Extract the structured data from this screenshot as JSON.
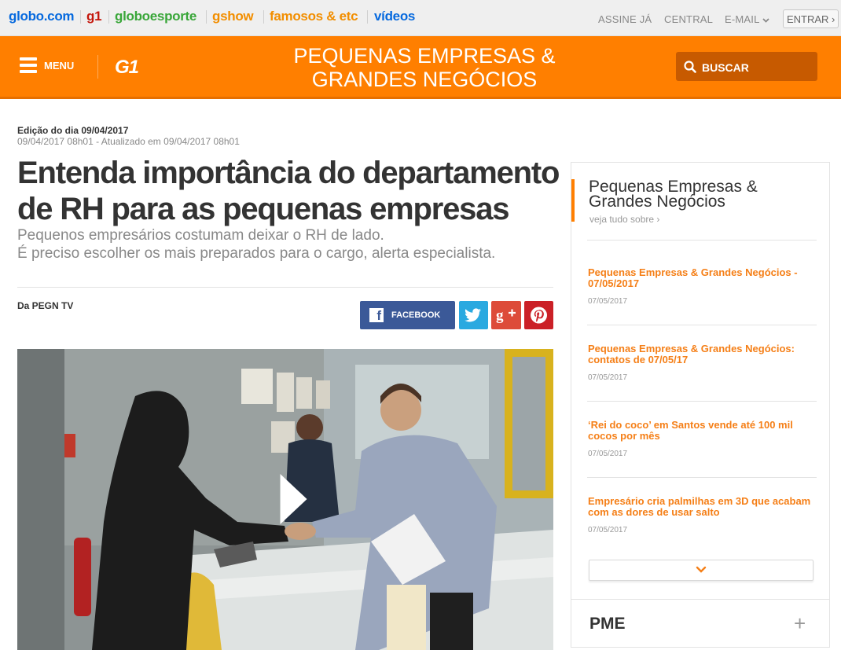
{
  "topbar": {
    "portals": [
      {
        "label": "globo.com",
        "color": "#0669de"
      },
      {
        "label": "g1",
        "color": "#c4170c"
      },
      {
        "label": "globoesporte",
        "color": "#39a639"
      },
      {
        "label": "gshow",
        "color": "#f28e00"
      },
      {
        "label": "famosos & etc",
        "color": "#f28e00"
      },
      {
        "label": "vídeos",
        "color": "#0669de"
      }
    ],
    "links": [
      "ASSINE JÁ",
      "CENTRAL",
      "E-MAIL"
    ],
    "login_label": "ENTRAR ›"
  },
  "header": {
    "menu_label": "MENU",
    "logo": "G1",
    "section_title": "PEQUENAS EMPRESAS & GRANDES NEGÓCIOS",
    "search_label": "BUSCAR",
    "color": "#ff7f00"
  },
  "article": {
    "edition": "Edição do dia 09/04/2017",
    "dateline": "09/04/2017 08h01 - Atualizado em 09/04/2017 08h01",
    "headline": "Entenda importância do departamento de RH para as pequenas empresas",
    "subtitle_line1": "Pequenos empresários costumam deixar o RH de lado.",
    "subtitle_line2": "É preciso escolher os mais preparados para o cargo, alerta especialista.",
    "byline": "Da PEGN TV",
    "share": {
      "facebook_label": "FACEBOOK"
    }
  },
  "sidebar": {
    "title": "Pequenas Empresas & Grandes Negócios",
    "see_all": "veja tudo sobre ›",
    "news": [
      {
        "title": "Pequenas Empresas & Grandes Negócios - 07/05/2017",
        "date": "07/05/2017"
      },
      {
        "title": "Pequenas Empresas & Grandes Negócios: contatos de 07/05/17",
        "date": "07/05/2017"
      },
      {
        "title": "‘Rei do coco’ em Santos vende até 100 mil cocos por mês",
        "date": "07/05/2017"
      },
      {
        "title": "Empresário cria palmilhas em 3D que acabam com as dores de usar salto",
        "date": "07/05/2017"
      }
    ],
    "pme_label": "PME",
    "pme_icon": "+"
  }
}
